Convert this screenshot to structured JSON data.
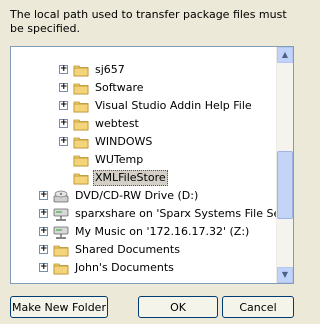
{
  "message": "The local path used to transfer package files must be specified.",
  "tree_items": [
    {
      "label": "sj657",
      "expander": "+",
      "icon": "folder-icon"
    },
    {
      "label": "Software",
      "expander": "+",
      "icon": "folder-icon"
    },
    {
      "label": "Visual Studio Addin Help File",
      "expander": "+",
      "icon": "folder-icon"
    },
    {
      "label": "webtest",
      "expander": "+",
      "icon": "folder-icon"
    },
    {
      "label": "WINDOWS",
      "expander": "+",
      "icon": "folder-icon"
    },
    {
      "label": "WUTemp",
      "expander": "",
      "icon": "folder-icon"
    },
    {
      "label": "XMLFileStore",
      "expander": "",
      "icon": "folder-icon",
      "selected": true
    },
    {
      "label": "DVD/CD-RW Drive (D:)",
      "expander": "+",
      "icon": "cd-drive-icon"
    },
    {
      "label": "sparxshare on 'Sparx Systems File Server (",
      "expander": "+",
      "icon": "network-drive-icon"
    },
    {
      "label": "My Music on '172.16.17.32' (Z:)",
      "expander": "+",
      "icon": "network-drive-icon"
    },
    {
      "label": "Shared Documents",
      "expander": "+",
      "icon": "folder-icon"
    },
    {
      "label": "John's Documents",
      "expander": "+",
      "icon": "folder-icon"
    }
  ],
  "buttons": {
    "make_new_folder": "Make New Folder",
    "ok": "OK",
    "cancel": "Cancel"
  },
  "colors": {
    "dialog_bg": "#ece9d8",
    "folder": "#f3d47a",
    "tree_border": "#7f9db9"
  }
}
